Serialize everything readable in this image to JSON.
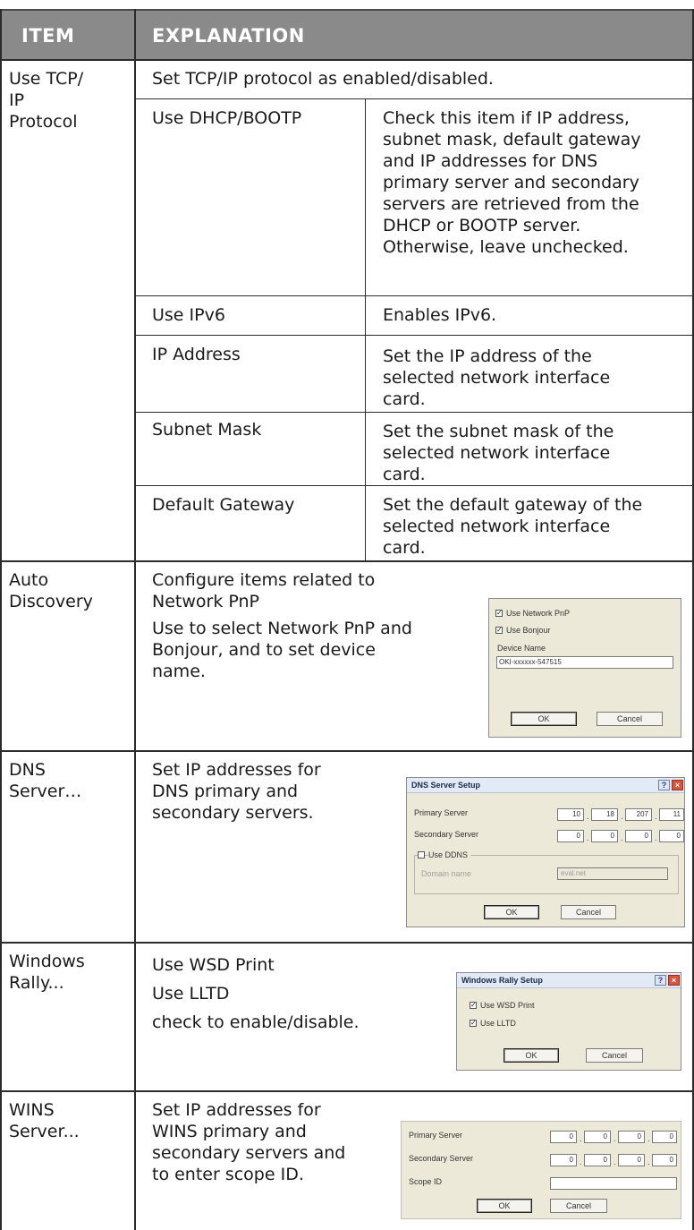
{
  "header": {
    "item": "ITEM",
    "explanation": "EXPLANATION"
  },
  "tcp": {
    "item_lines": [
      "Use TCP/",
      "IP",
      "Protocol"
    ],
    "desc": "Set TCP/IP protocol as enabled/disabled.",
    "rows": [
      {
        "label": "Use DHCP/BOOTP",
        "lines": [
          "Check this item if IP address,",
          "subnet mask, default gateway",
          "and IP addresses for DNS",
          "primary server and secondary",
          "servers are retrieved from the",
          "DHCP or BOOTP server.",
          "Otherwise, leave unchecked."
        ]
      },
      {
        "label": "Use IPv6",
        "lines": [
          "Enables IPv6."
        ]
      },
      {
        "label": "IP Address",
        "lines": [
          "Set the IP address of the",
          "selected network interface",
          "card."
        ]
      },
      {
        "label": "Subnet Mask",
        "lines": [
          "Set the subnet mask of the",
          "selected network interface",
          "card."
        ]
      },
      {
        "label": "Default Gateway",
        "lines": [
          "Set the default gateway of the",
          "selected network interface",
          "card."
        ]
      }
    ]
  },
  "auto": {
    "item_lines": [
      "Auto",
      "Discovery"
    ],
    "lines": [
      "Configure items related to",
      "Network PnP",
      "Use to select Network PnP and",
      "Bonjour, and to set device",
      "name."
    ],
    "dialog": {
      "cb1": "Use Network PnP",
      "cb2": "Use Bonjour",
      "device_label": "Device Name",
      "device_value": "OKI-xxxxxx-547515",
      "ok": "OK",
      "cancel": "Cancel"
    }
  },
  "dns": {
    "item_lines": [
      "DNS",
      "Server…"
    ],
    "lines": [
      "Set IP addresses for",
      "DNS primary and",
      "secondary servers."
    ],
    "dialog": {
      "title": "DNS Server Setup",
      "primary_label": "Primary Server",
      "primary": [
        "10",
        "18",
        "207",
        "11"
      ],
      "secondary_label": "Secondary Server",
      "secondary": [
        "0",
        "0",
        "0",
        "0"
      ],
      "ddns_label": "Use DDNS",
      "domain_label": "Domain name",
      "domain_value": "eval.net",
      "ok": "OK",
      "cancel": "Cancel"
    }
  },
  "rally": {
    "item_lines": [
      "Windows",
      "Rally..."
    ],
    "lines": [
      "Use WSD Print",
      "Use LLTD",
      "check to enable/disable."
    ],
    "dialog": {
      "title": "Windows Rally Setup",
      "cb1": "Use WSD Print",
      "cb2": "Use LLTD",
      "ok": "OK",
      "cancel": "Cancel"
    }
  },
  "wins": {
    "item_lines": [
      "WINS",
      "Server..."
    ],
    "lines": [
      "Set IP addresses for",
      "WINS primary and",
      "secondary servers and",
      "to enter scope ID."
    ],
    "dialog": {
      "primary_label": "Primary Server",
      "primary": [
        "0",
        "0",
        "0",
        "0"
      ],
      "secondary_label": "Secondary Server",
      "secondary": [
        "0",
        "0",
        "0",
        "0"
      ],
      "scope_label": "Scope ID",
      "ok": "OK",
      "cancel": "Cancel"
    }
  },
  "icons": {
    "help": "?",
    "close": "×",
    "check": "✓"
  }
}
